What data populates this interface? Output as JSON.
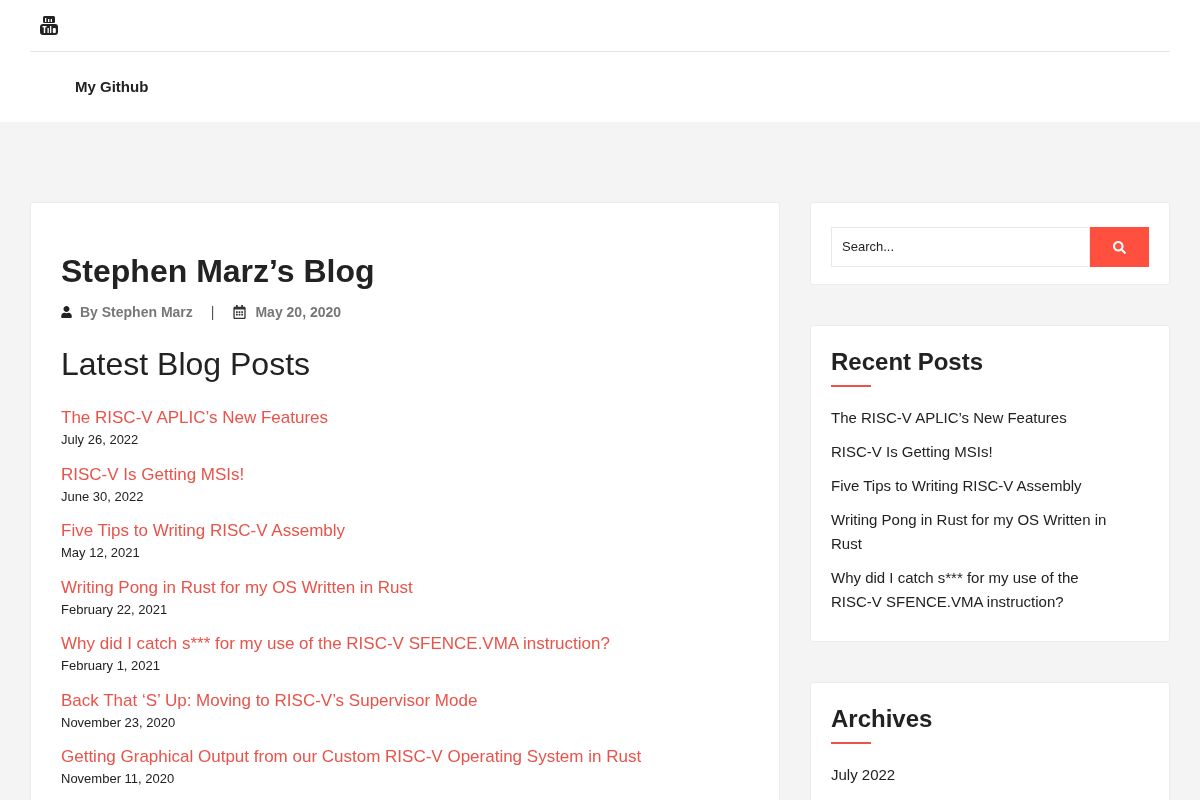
{
  "nav": {
    "items": [
      "My Github"
    ]
  },
  "article": {
    "title": "Stephen Marz’s Blog",
    "author": "By Stephen Marz",
    "separator": "|",
    "date": "May 20, 2020",
    "heading": "Latest Blog Posts",
    "posts": [
      {
        "title": "The RISC-V APLIC’s New Features",
        "date": "July 26, 2022"
      },
      {
        "title": "RISC-V Is Getting MSIs!",
        "date": "June 30, 2022"
      },
      {
        "title": "Five Tips to Writing RISC-V Assembly",
        "date": "May 12, 2021"
      },
      {
        "title": "Writing Pong in Rust for my OS Written in Rust",
        "date": "February 22, 2021"
      },
      {
        "title": "Why did I catch s*** for my use of the RISC-V SFENCE.VMA instruction?",
        "date": "February 1, 2021"
      },
      {
        "title": "Back That ‘S’ Up: Moving to RISC-V’s Supervisor Mode",
        "date": "November 23, 2020"
      },
      {
        "title": "Getting Graphical Output from our Custom RISC-V Operating System in Rust",
        "date": "November 11, 2020"
      }
    ]
  },
  "sidebar": {
    "search": {
      "placeholder": "Search..."
    },
    "widgets": [
      {
        "title": "Recent Posts",
        "links": [
          "The RISC-V APLIC’s New Features",
          "RISC-V Is Getting MSIs!",
          "Five Tips to Writing RISC-V Assembly",
          "Writing Pong in Rust for my OS Written in Rust",
          "Why did I catch s*** for my use of the RISC-V SFENCE.VMA instruction?"
        ]
      },
      {
        "title": "Archives",
        "links": [
          "July 2022"
        ]
      }
    ]
  }
}
